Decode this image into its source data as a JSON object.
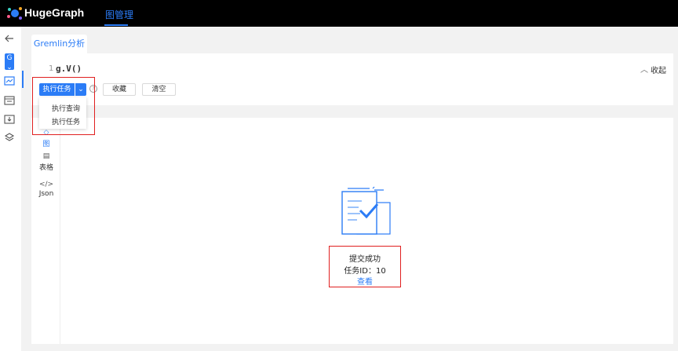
{
  "app": {
    "brand": "HugeGraph",
    "nav_item": "图管理"
  },
  "sidebar": {
    "graph_badge": "G",
    "icons": [
      "back-arrow-icon",
      "graph-select-icon",
      "graph-analysis-icon",
      "schema-icon",
      "import-icon",
      "layers-icon"
    ]
  },
  "tabs": [
    {
      "label": "Gremlin分析"
    }
  ],
  "editor": {
    "line_number": "1",
    "code": "g.V()",
    "collapse_label": "收起"
  },
  "toolbar": {
    "execute_label": "执行任务",
    "favorite_label": "收藏",
    "clear_label": "清空",
    "help_symbol": "?"
  },
  "dropdown": {
    "items": [
      "执行查询",
      "执行任务"
    ]
  },
  "result": {
    "view_tabs": [
      {
        "label": "图"
      },
      {
        "label": "表格"
      },
      {
        "label": "Json"
      }
    ],
    "status_title": "提交成功",
    "task_id_label": "任务ID：10",
    "view_link": "查看"
  },
  "colors": {
    "accent": "#2b7cf6",
    "topbar": "#000000",
    "highlight": "#e02020"
  }
}
